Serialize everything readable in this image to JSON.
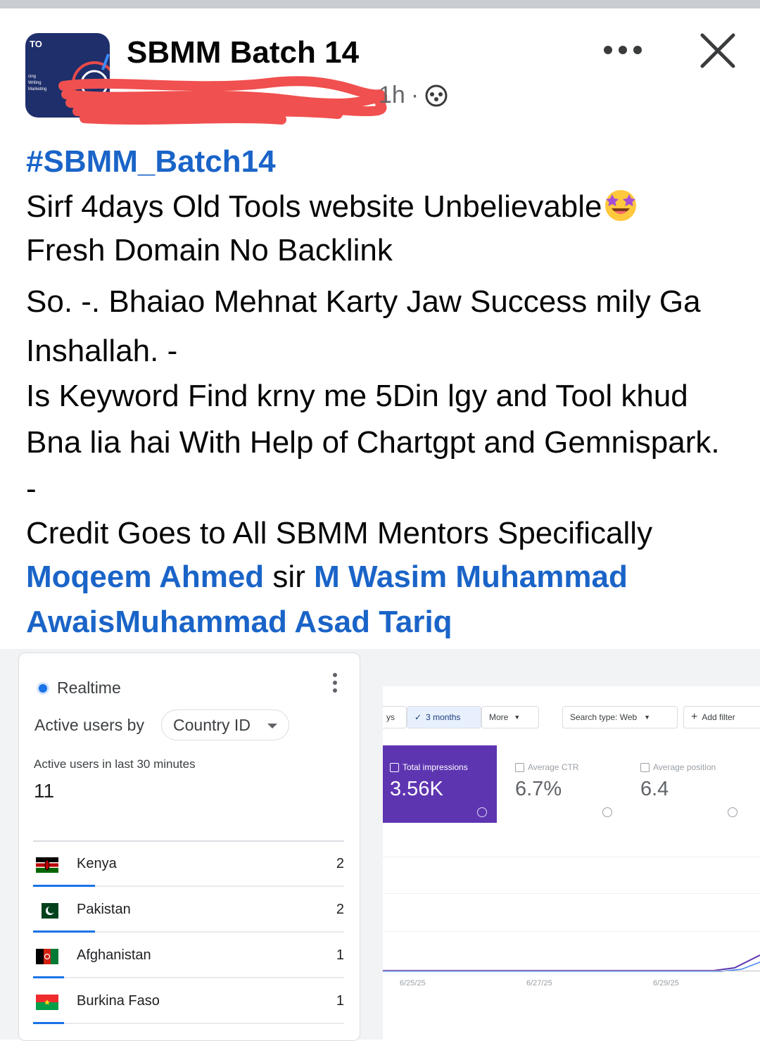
{
  "post": {
    "group_name": "SBMM Batch 14",
    "time": "1h",
    "avatar_text": "TO",
    "avatar_lines": [
      "cing",
      "Writing",
      "Marketing"
    ],
    "hashtag": "#SBMM_Batch14",
    "line1": "Sirf 4days Old Tools website Unbelievable",
    "line2": "Fresh Domain No Backlink",
    "line3": "So. -. Bhaiao Mehnat Karty Jaw Success mily Ga Inshallah. -",
    "line4": "Is Keyword Find krny me 5Din lgy and Tool khud Bna lia hai With Help of Chartgpt and Gemnispark. -",
    "line5": "Credit Goes to All SBMM Mentors Specifically",
    "mention1": "Moqeem Ahmed",
    "connector": " sir ",
    "mention2": "M Wasim Muhammad AwaisMuhammad Asad Tariq"
  },
  "analytics": {
    "title": "Realtime",
    "active_by": "Active users by",
    "dimension": "Country ID",
    "last30_label": "Active users in last 30 minutes",
    "active_count": "11",
    "rows": [
      {
        "country": "Kenya",
        "value": "2",
        "flag": "kenya",
        "share": 0.2
      },
      {
        "country": "Pakistan",
        "value": "2",
        "flag": "pakistan",
        "share": 0.2
      },
      {
        "country": "Afghanistan",
        "value": "1",
        "flag": "afghanistan",
        "share": 0.1
      },
      {
        "country": "Burkina Faso",
        "value": "1",
        "flag": "burkina-faso",
        "share": 0.1
      }
    ]
  },
  "search_console": {
    "filters": {
      "days_partial": "ys",
      "range": "3 months",
      "more": "More",
      "search_type": "Search type: Web",
      "add_filter": "Add filter"
    },
    "metrics": [
      {
        "label": "Total impressions",
        "value": "3.56K",
        "active": true
      },
      {
        "label": "Average CTR",
        "value": "6.7%",
        "active": false
      },
      {
        "label": "Average position",
        "value": "6.4",
        "active": false
      }
    ],
    "dates": [
      "6/25/25",
      "6/27/25",
      "6/29/25"
    ]
  },
  "colors": {
    "link": "#1a64c8",
    "ga_blue": "#1a73e8",
    "sc_purple": "#5e35b1",
    "redaction": "#f0504f"
  },
  "icons": [
    "more-options-icon",
    "close-icon",
    "globe-icon",
    "star-eyes-emoji-icon",
    "kebab-icon",
    "checkmark-icon",
    "plus-icon"
  ]
}
